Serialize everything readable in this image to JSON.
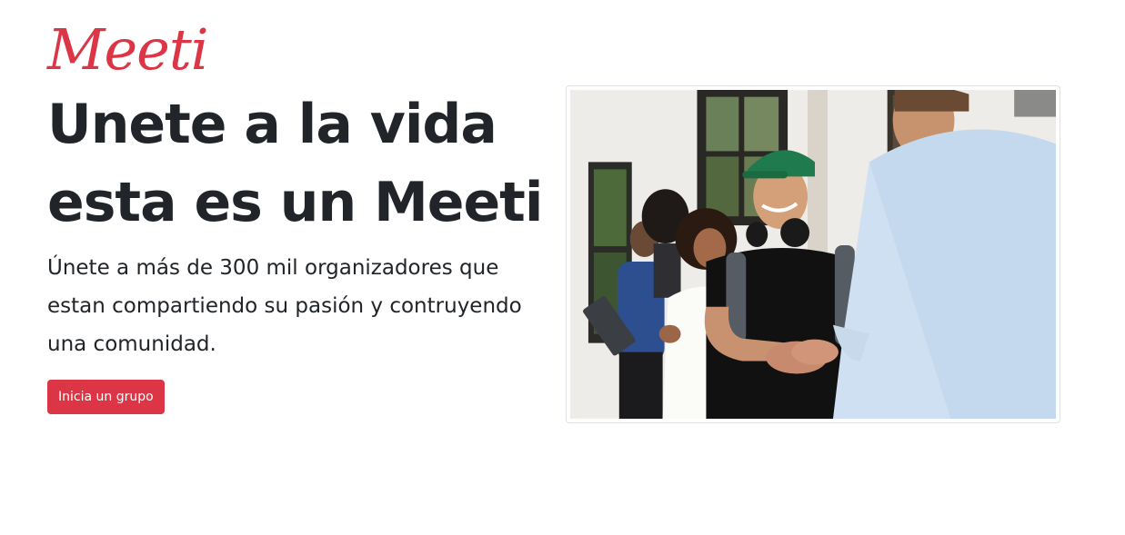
{
  "brand": {
    "logo_text": "Meeti",
    "accent_color": "#dc3545"
  },
  "hero": {
    "headline": "Unete a la vida esta es un Meeti",
    "lead": "Únete a más de 300 mil organizadores que estan compartiendo su pasión y contruyendo una comunidad.",
    "cta_label": "Inicia un grupo"
  },
  "image": {
    "description_icon": "people-handshake-photo"
  }
}
